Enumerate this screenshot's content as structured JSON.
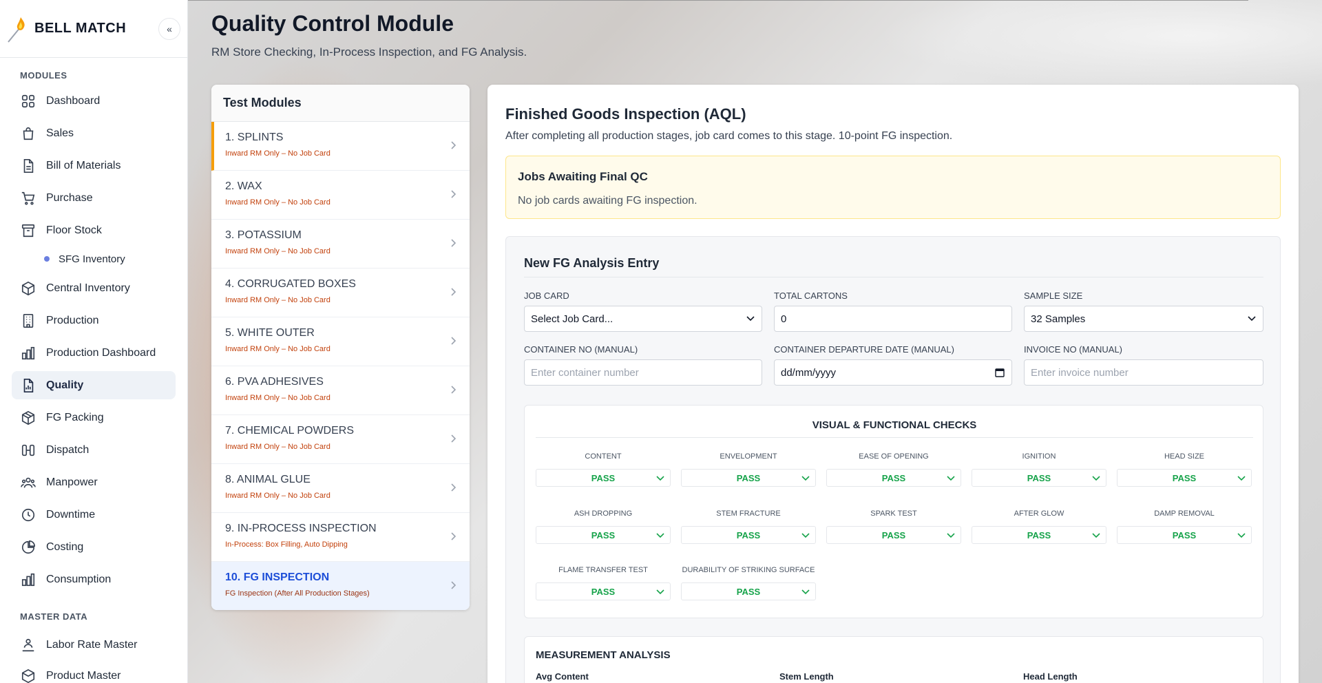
{
  "brand": {
    "name": "BELL MATCH",
    "collapse_icon": "«"
  },
  "sidebar": {
    "modules_label": "MODULES",
    "items": [
      {
        "label": "Dashboard",
        "icon": "grid-icon"
      },
      {
        "label": "Sales",
        "icon": "shopping-bag-icon"
      },
      {
        "label": "Bill of Materials",
        "icon": "file-text-icon"
      },
      {
        "label": "Purchase",
        "icon": "cart-icon"
      },
      {
        "label": "Floor Stock",
        "icon": "archive-icon"
      },
      {
        "label": "Central Inventory",
        "icon": "box-icon"
      },
      {
        "label": "Production",
        "icon": "building-icon"
      },
      {
        "label": "Production Dashboard",
        "icon": "bar-chart-icon"
      },
      {
        "label": "Quality",
        "icon": "report-icon"
      },
      {
        "label": "FG Packing",
        "icon": "package-icon"
      },
      {
        "label": "Dispatch",
        "icon": "dispatch-icon"
      },
      {
        "label": "Manpower",
        "icon": "users-icon"
      },
      {
        "label": "Downtime",
        "icon": "clock-icon"
      },
      {
        "label": "Costing",
        "icon": "pie-chart-icon"
      },
      {
        "label": "Consumption",
        "icon": "bar-chart-icon"
      }
    ],
    "sub_item": "SFG Inventory",
    "master_label": "MASTER DATA",
    "master_items": [
      {
        "label": "Labor Rate Master",
        "icon": "user-rate-icon"
      },
      {
        "label": "Product Master",
        "icon": "product-icon"
      }
    ],
    "active": "Quality"
  },
  "page": {
    "title": "Quality Control Module",
    "subtitle": "RM Store Checking, In-Process Inspection, and FG Analysis."
  },
  "test_modules": {
    "title": "Test Modules",
    "items": [
      {
        "name": "1. SPLINTS",
        "sub": "Inward RM Only – No Job Card"
      },
      {
        "name": "2. WAX",
        "sub": "Inward RM Only – No Job Card"
      },
      {
        "name": "3. POTASSIUM",
        "sub": "Inward RM Only – No Job Card"
      },
      {
        "name": "4. CORRUGATED BOXES",
        "sub": "Inward RM Only – No Job Card"
      },
      {
        "name": "5. WHITE OUTER",
        "sub": "Inward RM Only – No Job Card"
      },
      {
        "name": "6. PVA ADHESIVES",
        "sub": "Inward RM Only – No Job Card"
      },
      {
        "name": "7. CHEMICAL POWDERS",
        "sub": "Inward RM Only – No Job Card"
      },
      {
        "name": "8. ANIMAL GLUE",
        "sub": "Inward RM Only – No Job Card"
      },
      {
        "name": "9. IN-PROCESS INSPECTION",
        "sub": "In-Process: Box Filling, Auto Dipping"
      },
      {
        "name": "10. FG INSPECTION",
        "sub": "FG Inspection (After All Production Stages)"
      }
    ]
  },
  "panel": {
    "title": "Finished Goods Inspection (AQL)",
    "desc": "After completing all production stages, job card comes to this stage. 10-point FG inspection.",
    "awaiting": {
      "title": "Jobs Awaiting Final QC",
      "text": "No job cards awaiting FG inspection."
    },
    "entry": {
      "title": "New FG Analysis Entry",
      "fields": {
        "job_card": {
          "label": "JOB CARD",
          "value": "Select Job Card..."
        },
        "total_cartons": {
          "label": "TOTAL CARTONS",
          "value": "0"
        },
        "sample_size": {
          "label": "SAMPLE SIZE",
          "value": "32 Samples"
        },
        "container_no": {
          "label": "CONTAINER NO (MANUAL)",
          "placeholder": "Enter container number"
        },
        "departure_date": {
          "label": "CONTAINER DEPARTURE DATE (MANUAL)",
          "value": "dd/mm/yyyy"
        },
        "invoice_no": {
          "label": "INVOICE NO (MANUAL)",
          "placeholder": "Enter invoice number"
        }
      }
    },
    "visual": {
      "title": "VISUAL & FUNCTIONAL CHECKS",
      "checks": [
        {
          "label": "CONTENT",
          "value": "PASS"
        },
        {
          "label": "ENVELOPMENT",
          "value": "PASS"
        },
        {
          "label": "EASE OF OPENING",
          "value": "PASS"
        },
        {
          "label": "IGNITION",
          "value": "PASS"
        },
        {
          "label": "HEAD SIZE",
          "value": "PASS"
        },
        {
          "label": "ASH DROPPING",
          "value": "PASS"
        },
        {
          "label": "STEM FRACTURE",
          "value": "PASS"
        },
        {
          "label": "SPARK TEST",
          "value": "PASS"
        },
        {
          "label": "AFTER GLOW",
          "value": "PASS"
        },
        {
          "label": "DAMP REMOVAL",
          "value": "PASS"
        },
        {
          "label": "FLAME TRANSFER TEST",
          "value": "PASS"
        },
        {
          "label": "DURABILITY OF STRIKING SURFACE",
          "value": "PASS"
        }
      ]
    },
    "measurement": {
      "title": "MEASUREMENT ANALYSIS",
      "columns": [
        "Avg Content",
        "Stem Length",
        "Head Length"
      ]
    }
  },
  "colors": {
    "accent": "#f59e0b",
    "active_link": "#1d4ed8",
    "pass": "#16a34a",
    "warning_bg": "#fffbeb"
  }
}
